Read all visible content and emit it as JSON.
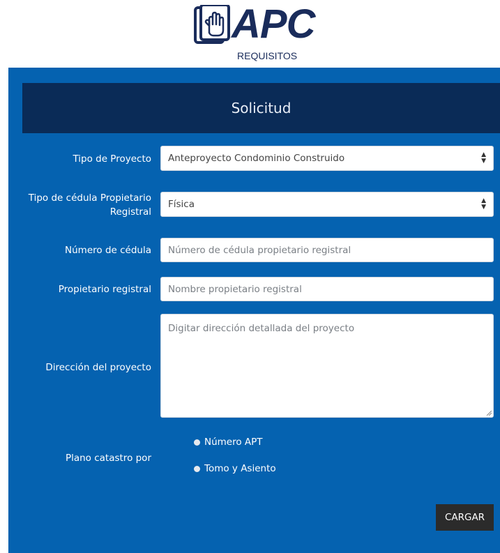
{
  "logo": {
    "name": "APC",
    "subtitle": "REQUISITOS"
  },
  "form": {
    "title": "Solicitud",
    "tipo_proyecto": {
      "label": "Tipo de Proyecto",
      "value": "Anteproyecto Condominio Construido"
    },
    "tipo_cedula": {
      "label_line1": "Tipo de cédula Propietario",
      "label_line2": "Registral",
      "value": "Física"
    },
    "numero_cedula": {
      "label": "Número de cédula",
      "placeholder": "Número de cédula propietario registral"
    },
    "propietario": {
      "label": "Propietario registral",
      "placeholder": "Nombre propietario registral"
    },
    "direccion": {
      "label": "Dirección del proyecto",
      "placeholder": "Digitar dirección detallada del proyecto"
    },
    "plano": {
      "label": "Plano catastro por",
      "options": [
        "Número APT",
        "Tomo y Asiento"
      ]
    },
    "submit_label": "CARGAR"
  },
  "colors": {
    "panel": "#0562b0",
    "header": "#0a2b57",
    "logo": "#1a2c5b",
    "button": "#2b2b2b"
  }
}
